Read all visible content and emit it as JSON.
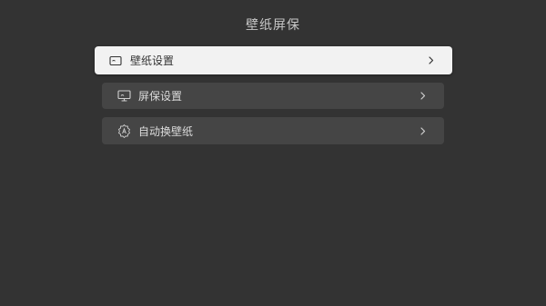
{
  "header": {
    "title": "壁纸屏保"
  },
  "menu": {
    "items": [
      {
        "label": "壁纸设置",
        "icon": "wallpaper-icon",
        "focused": true
      },
      {
        "label": "屏保设置",
        "icon": "screensaver-icon",
        "focused": false
      },
      {
        "label": "自动换壁纸",
        "icon": "auto-switch-icon",
        "focused": false
      }
    ]
  },
  "colors": {
    "background": "#333333",
    "item_background": "#454545",
    "item_focused_background": "#f2f2f2",
    "text_light": "#dcdcdc",
    "text_dark": "#333333"
  }
}
